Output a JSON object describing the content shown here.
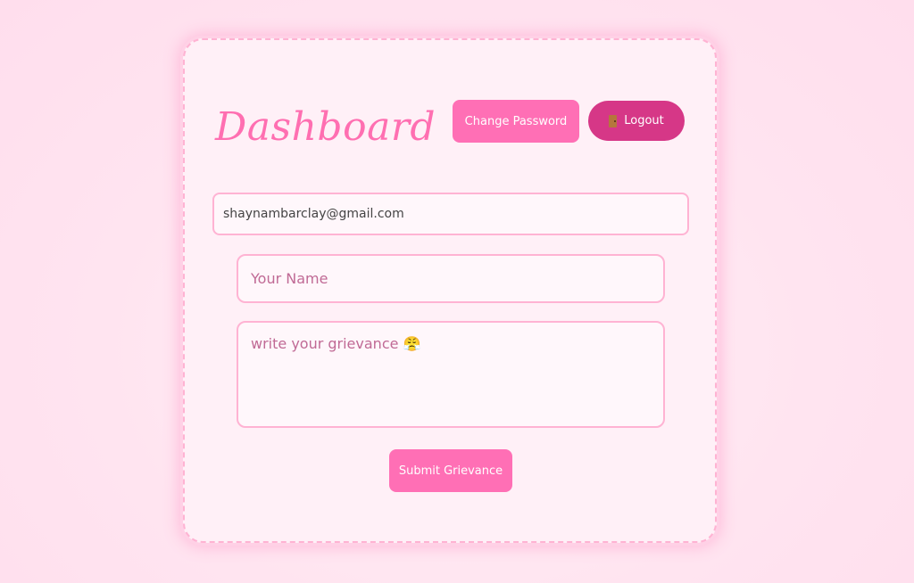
{
  "header": {
    "title": "Dashboard",
    "change_password_label": "Change Password",
    "logout_label": "Logout",
    "logout_icon": "door-icon"
  },
  "form": {
    "email_value": "shaynambarclay@gmail.com",
    "name_placeholder": "Your Name",
    "grievance_placeholder": "write your grievance 😤",
    "submit_label": "Submit Grievance"
  },
  "colors": {
    "accent": "#ff6fb5",
    "logout": "#d63787",
    "title": "#ff6fb1",
    "border": "#ffb3d3"
  }
}
